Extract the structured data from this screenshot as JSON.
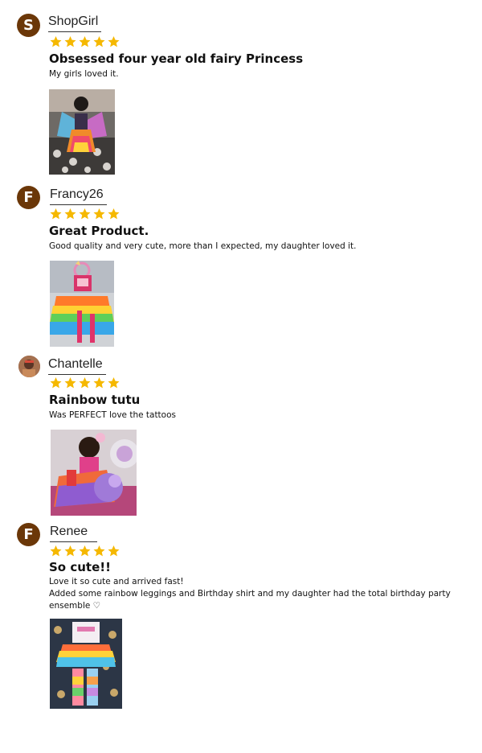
{
  "reviews": [
    {
      "initial": "S",
      "name": "ShopGirl",
      "stars": 5,
      "title": "Obsessed four year old fairy Princess",
      "body": [
        "My girls loved it."
      ],
      "photo": "girl-in-rainbow-fairy-wings-photo"
    },
    {
      "initial": "F",
      "name": "Francy26",
      "stars": 5,
      "title": "Great Product.",
      "body": [
        "Good quality and very cute, more than I expected, my daughter loved it."
      ],
      "photo": "rainbow-tutu-and-unicorn-headband-photo"
    },
    {
      "initial": "",
      "name": "Chantelle",
      "stars": 5,
      "title": "Rainbow tutu",
      "body": [
        "Was PERFECT love the tattoos"
      ],
      "photo": "toddler-with-unicorn-plush-photo"
    },
    {
      "initial": "F",
      "name": "Renee",
      "stars": 5,
      "title": "So cute!!",
      "body": [
        "Love it so cute and arrived fast!",
        "Added some rainbow leggings and Birthday shirt and my daughter had the total birthday party",
        "ensemble ♡"
      ],
      "photo": "birthday-outfit-flatlay-photo"
    }
  ],
  "colors": {
    "avatar_bg": "#6b3708",
    "star": "#f5b800",
    "text": "#111111"
  },
  "icons": {
    "star": "star-icon"
  }
}
